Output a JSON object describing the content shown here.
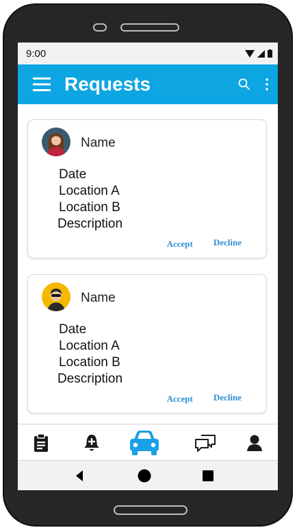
{
  "status_bar": {
    "time": "9:00"
  },
  "app_bar": {
    "title": "Requests",
    "menu_icon": "menu-icon",
    "search_icon": "search-icon",
    "more_icon": "more-vert-icon"
  },
  "requests": [
    {
      "name": "Name",
      "avatar": "avatar-woman",
      "date": "Date",
      "location_a": "Location A",
      "location_b": "Location B",
      "description": "Description",
      "accept_label": "Accept",
      "decline_label": "Decline"
    },
    {
      "name": "Name",
      "avatar": "avatar-man-sunglasses",
      "date": "Date",
      "location_a": "Location A",
      "location_b": "Location B",
      "description": "Description",
      "accept_label": "Accept",
      "decline_label": "Decline"
    }
  ],
  "bottom_nav": {
    "items": [
      {
        "icon": "clipboard-icon"
      },
      {
        "icon": "bell-plus-icon"
      },
      {
        "icon": "car-icon",
        "active": true
      },
      {
        "icon": "chat-icon"
      },
      {
        "icon": "person-icon"
      }
    ]
  },
  "colors": {
    "app_bar": "#0da5e2",
    "action_text": "#2d8fd6",
    "nav_icon": "#1a1a1a",
    "nav_active": "#1aa0e6"
  }
}
